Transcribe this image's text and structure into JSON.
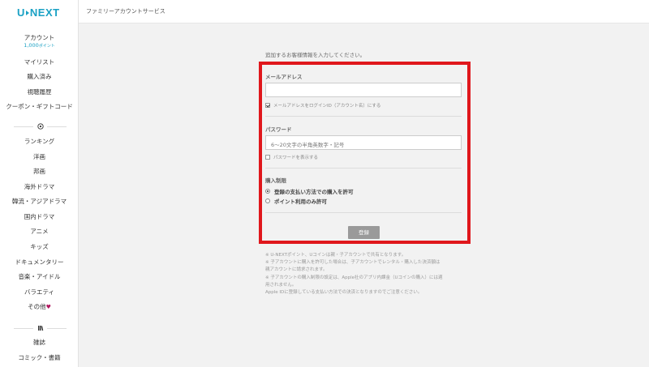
{
  "brand": {
    "logo_left": "U",
    "logo_right": "NEXT",
    "color": "#1aa1c4"
  },
  "header": {
    "title": "ファミリーアカウントサービス"
  },
  "sidebar": {
    "account": {
      "label": "アカウント",
      "points": "1,000",
      "points_unit": "ポイント"
    },
    "items_top": [
      "マイリスト",
      "購入済み",
      "視聴履歴",
      "クーポン・ギフトコード"
    ],
    "video_icon": "play-circle-icon",
    "genres": [
      "ランキング",
      "洋画",
      "邦画",
      "海外ドラマ",
      "韓流・アジアドラマ",
      "国内ドラマ",
      "アニメ",
      "キッズ",
      "ドキュメンタリー",
      "音楽・アイドル",
      "バラエティ",
      "その他"
    ],
    "other_heart": "♥",
    "books_icon": "books-icon",
    "books": [
      "雑誌",
      "コミック・書籍"
    ]
  },
  "form": {
    "intro": "追加するお客様情報を入力してください。",
    "email": {
      "label": "メールアドレス",
      "value": "",
      "placeholder": "",
      "login_check": "メールアドレスをログインID（アカウント名）にする",
      "login_checked": true
    },
    "password": {
      "label": "パスワード",
      "placeholder": "6〜20文字の半角英数字・記号",
      "show_check": "パスワードを表示する",
      "show_checked": false
    },
    "purchase": {
      "label": "購入制限",
      "options": [
        "登録の支払い方法での購入を許可",
        "ポイント利用のみ許可"
      ],
      "selected_index": 0
    },
    "submit": "登録"
  },
  "notes": [
    "※ U-NEXTポイント、Uコインは親・子アカウントで共有となります。",
    "※ 子アカウントに購入を許可した場合は、子アカウントでレンタル・購入した決済額は",
    "親アカウントに請求されます。",
    "※ 子アカウントの購入制限の設定は、Apple社のアプリ内課金（Uコインの購入）には適",
    "用されません。",
    "Apple IDに登録している支払い方法での決済となりますのでご注意ください。"
  ],
  "colors": {
    "highlight_border": "#e0171c",
    "accent": "#1aa1c4",
    "heart": "#b0165e"
  }
}
